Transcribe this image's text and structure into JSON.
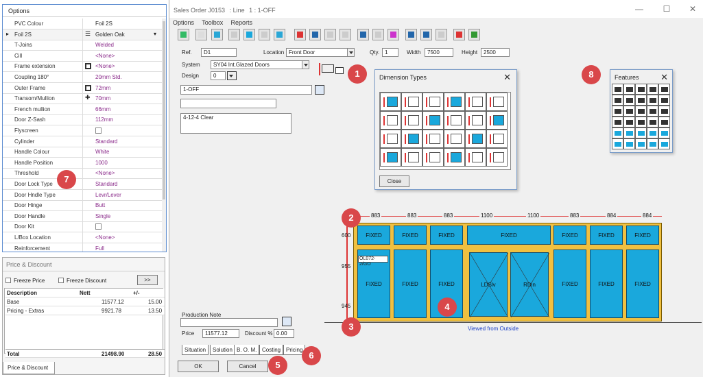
{
  "window": {
    "title": "Sales Order J0153",
    "line": ": Line",
    "line_no": "1 : 1-OFF",
    "minimize": "—",
    "maximize": "☐",
    "close": "✕"
  },
  "menu": [
    "Options",
    "Toolbox",
    "Reports"
  ],
  "form": {
    "ref_label": "Ref.",
    "ref": "D1",
    "location_label": "Location",
    "location": "Front Door",
    "qty_label": "Qty.",
    "qty": "1",
    "width_label": "Width",
    "width": "7500",
    "height_label": "Height",
    "height": "2500",
    "system_label": "System",
    "system": "SY04  Int.Glazed Doors",
    "design_label": "Design",
    "design": "0",
    "desc": "1-OFF",
    "glass": "4-12-4 Clear",
    "production_note_label": "Production Note",
    "price_label": "Price",
    "price": "11577.12",
    "discount_label": "Discount %",
    "discount": "0.00"
  },
  "dimension_types": {
    "title": "Dimension Types",
    "close": "✕",
    "button": "Close"
  },
  "features": {
    "title": "Features",
    "close": "✕"
  },
  "drawing": {
    "top_dims": [
      "883",
      "883",
      "883",
      "1100",
      "1100",
      "883",
      "884",
      "884"
    ],
    "side_dims": [
      "600",
      "955",
      "945"
    ],
    "fixed": "FIXED",
    "tag": "OL072-2/GO",
    "door_left": "LDSlv",
    "door_right": "RDin",
    "caption": "Viewed from Outside"
  },
  "tabs": [
    "Situation",
    "Solution",
    "B. O. M.",
    "Costing",
    "Pricing"
  ],
  "buttons": {
    "ok": "OK",
    "cancel": "Cancel"
  },
  "callouts": [
    "1",
    "2",
    "3",
    "4",
    "5",
    "6",
    "7",
    "8"
  ],
  "options": {
    "title": "Options",
    "rows": [
      {
        "k": "PVC Colour",
        "v": "Foil 2S",
        "dark": true
      },
      {
        "k": "Foil 2S",
        "v": "Golden Oak",
        "dark": true,
        "sel": true
      },
      {
        "k": "T-Joins",
        "v": "Welded"
      },
      {
        "k": "Cill",
        "v": "<None>"
      },
      {
        "k": "Frame extension",
        "v": "<None>",
        "icon": true
      },
      {
        "k": "Coupling 180°",
        "v": "20mm Std."
      },
      {
        "k": "Outer Frame",
        "v": "72mm",
        "icon": true
      },
      {
        "k": "Transom/Mullion",
        "v": "70mm",
        "plus": true
      },
      {
        "k": "French mullion",
        "v": "66mm"
      },
      {
        "k": "Door Z-Sash",
        "v": "112mm"
      },
      {
        "k": "Flyscreen",
        "v": "",
        "check": true
      },
      {
        "k": "Cylinder",
        "v": "Standard"
      },
      {
        "k": "Handle Colour",
        "v": "White"
      },
      {
        "k": "Handle Position",
        "v": "1000"
      },
      {
        "k": "Threshold",
        "v": "<None>"
      },
      {
        "k": "Door Lock Type",
        "v": "Standard"
      },
      {
        "k": "Door Hndle Type",
        "v": "Levr/Lever"
      },
      {
        "k": "Door Hinge",
        "v": "Butt"
      },
      {
        "k": "Door Handle",
        "v": "Single"
      },
      {
        "k": "Door Kit",
        "v": "",
        "check": true
      },
      {
        "k": "L/Box Location",
        "v": "<None>"
      },
      {
        "k": "Reinforcement",
        "v": "Full"
      }
    ]
  },
  "price_discount": {
    "title": "Price & Discount",
    "freeze_price": "Freeze Price",
    "freeze_discount": "Freeze Discount",
    "more": ">>",
    "headers": [
      "Description",
      "Nett",
      "+/-"
    ],
    "rows": [
      [
        "Base",
        "11577.12",
        "15.00"
      ],
      [
        "Pricing - Extras",
        "9921.78",
        "13.50"
      ]
    ],
    "total": [
      "Total",
      "21498.90",
      "28.50"
    ],
    "tab": "Price & Discount"
  }
}
